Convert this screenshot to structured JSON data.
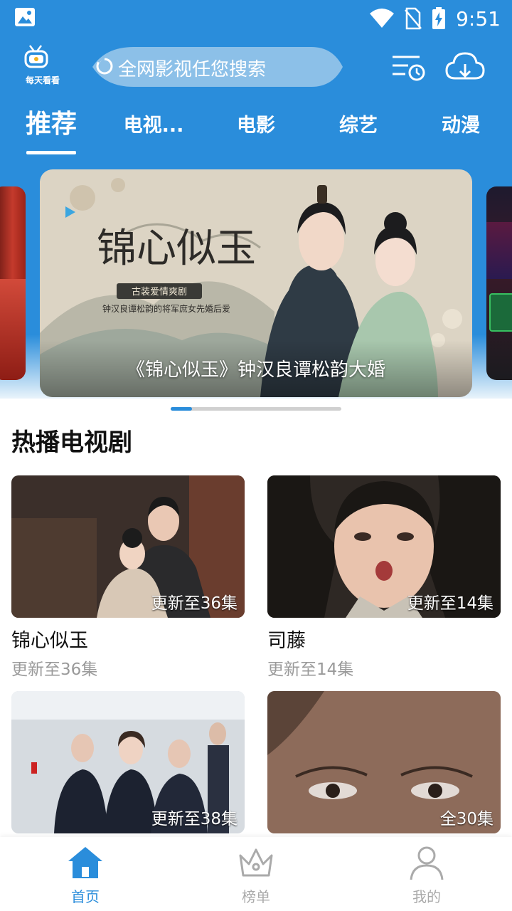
{
  "status_bar": {
    "time": "9:51"
  },
  "app": {
    "logo_text": "每天看看"
  },
  "search": {
    "placeholder": "全网影视任您搜索"
  },
  "tabs": [
    {
      "label": "推荐",
      "active": true
    },
    {
      "label": "电视..."
    },
    {
      "label": "电影"
    },
    {
      "label": "综艺"
    },
    {
      "label": "动漫"
    }
  ],
  "banner": {
    "caption": "《锦心似玉》钟汉良谭松韵大婚",
    "art_title": "锦心似玉",
    "art_subtitle1": "古装爱情爽剧",
    "art_subtitle2": "钟汉良谭松韵的将军庶女先婚后爱"
  },
  "carousel": {
    "current": 1,
    "total": 8
  },
  "section": {
    "title": "热播电视剧"
  },
  "cards": [
    {
      "badge": "更新至36集",
      "title": "锦心似玉",
      "sub": "更新至36集"
    },
    {
      "badge": "更新至14集",
      "title": "司藤",
      "sub": "更新至14集"
    },
    {
      "badge": "更新至38集",
      "title": "",
      "sub": ""
    },
    {
      "badge": "全30集",
      "title": "",
      "sub": ""
    }
  ],
  "nav": [
    {
      "label": "首页",
      "icon": "home-icon",
      "active": true
    },
    {
      "label": "榜单",
      "icon": "crown-icon"
    },
    {
      "label": "我的",
      "icon": "person-icon"
    }
  ],
  "colors": {
    "primary": "#2a8ddb",
    "inactive": "#aaaaaa"
  }
}
